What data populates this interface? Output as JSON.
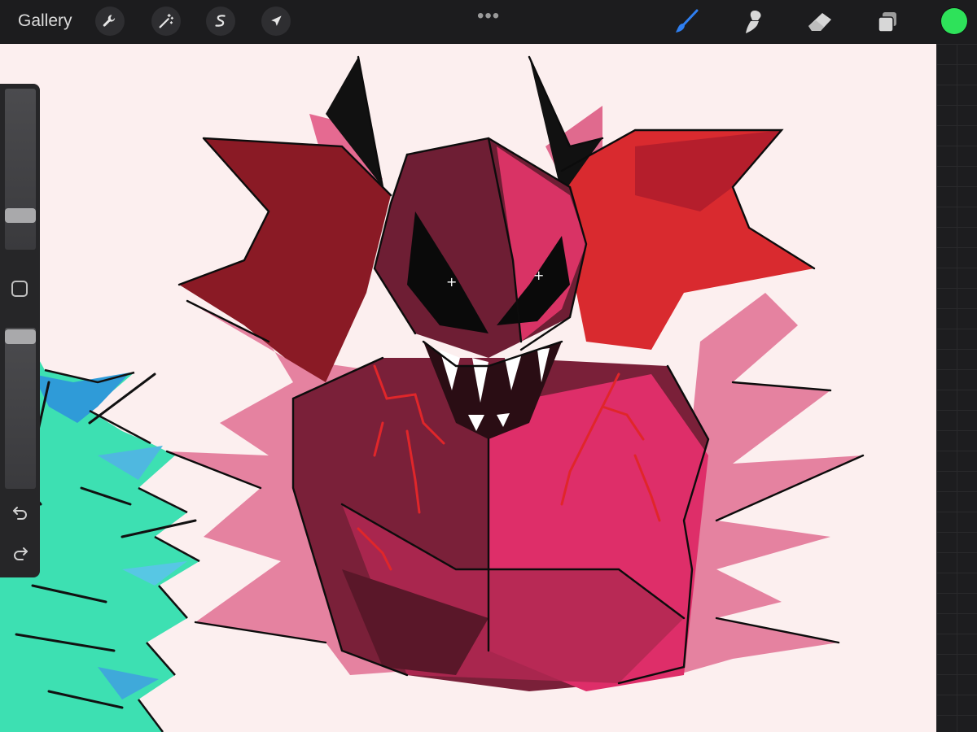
{
  "toolbar": {
    "gallery_label": "Gallery",
    "more_label": "•••",
    "icons": [
      "wrench-icon",
      "magic-wand-icon",
      "selection-s-icon",
      "move-arrow-icon",
      "brush-icon",
      "smudge-icon",
      "eraser-icon",
      "layers-icon"
    ],
    "accent_color": "#2f7ff0",
    "current_color": "#2ee25a"
  },
  "sidebar": {
    "brush_size": 0.78,
    "brush_opacity": 0.06
  },
  "canvas": {
    "background": "#fcefef"
  }
}
